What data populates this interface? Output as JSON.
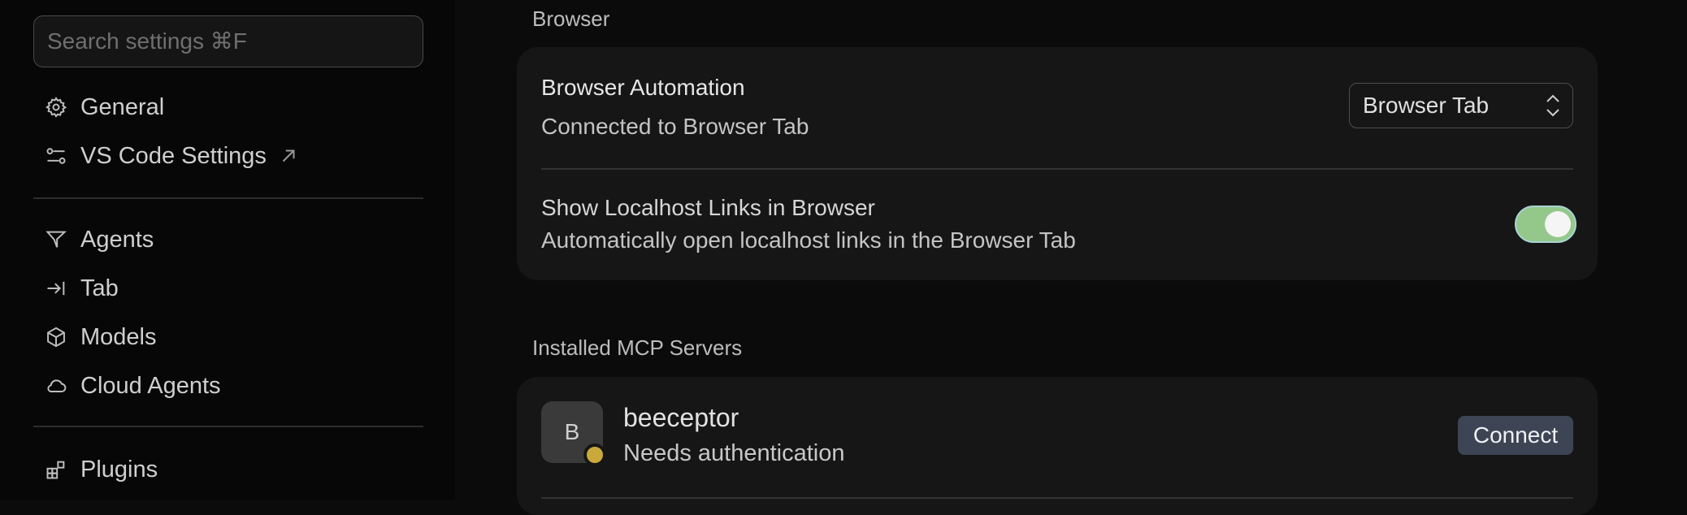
{
  "sidebar": {
    "search_placeholder": "Search settings ⌘F",
    "items": [
      {
        "label": "General",
        "icon": "gear-icon"
      },
      {
        "label": "VS Code Settings",
        "icon": "sliders-icon",
        "external": true
      },
      {
        "label": "Agents",
        "icon": "agent-icon"
      },
      {
        "label": "Tab",
        "icon": "tab-arrow-icon"
      },
      {
        "label": "Models",
        "icon": "cube-icon"
      },
      {
        "label": "Cloud Agents",
        "icon": "cloud-icon"
      },
      {
        "label": "Plugins",
        "icon": "plugins-icon"
      }
    ]
  },
  "browser_section": {
    "label": "Browser",
    "automation": {
      "title": "Browser Automation",
      "description": "Connected to Browser Tab",
      "selected_option": "Browser Tab"
    },
    "localhost_links": {
      "title": "Show Localhost Links in Browser",
      "description": "Automatically open localhost links in the Browser Tab",
      "enabled": true
    }
  },
  "mcp_section": {
    "label": "Installed MCP Servers",
    "servers": [
      {
        "avatar_letter": "B",
        "name": "beeceptor",
        "status": "Needs authentication",
        "status_color": "#c9a93a",
        "action_label": "Connect"
      }
    ]
  },
  "colors": {
    "toggle_on": "#93c88a",
    "connect_button": "#3d4453"
  }
}
